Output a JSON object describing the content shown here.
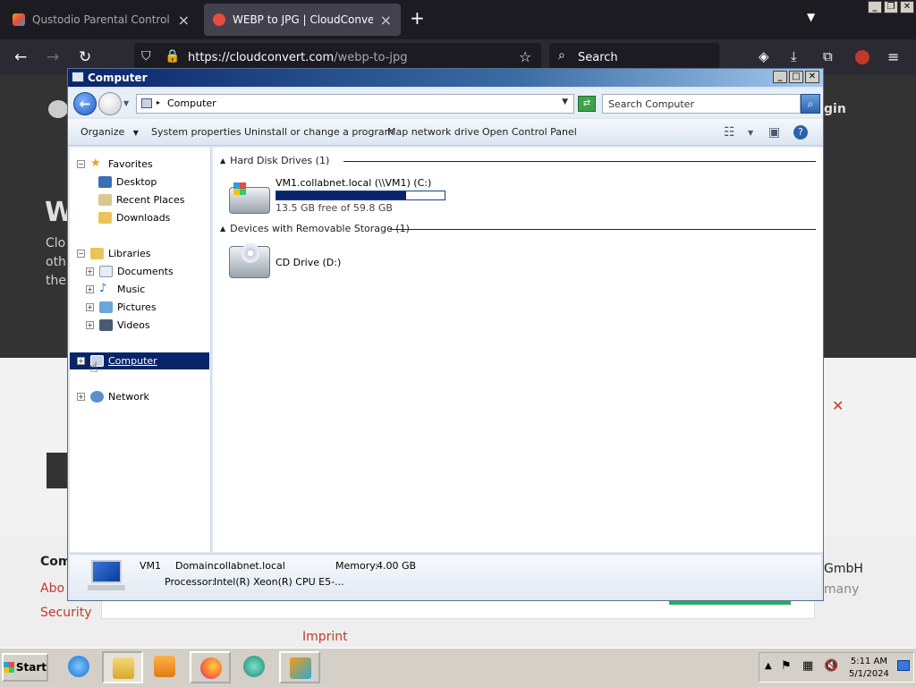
{
  "browser": {
    "tabs": [
      {
        "label": "Qustodio Parental Control App - A",
        "active": false
      },
      {
        "label": "WEBP to JPG | CloudConvert",
        "active": true
      }
    ],
    "url_host": "https://cloudconvert.com",
    "url_path": "/webp-to-jpg",
    "search_label": "Search",
    "win_buttons": [
      "_",
      "❐",
      "✕"
    ]
  },
  "site": {
    "title_letter": "W",
    "lines": [
      "Clo",
      "oth",
      "the"
    ],
    "login_partial": "gin",
    "footer_col1_head": "Com",
    "footer_col1_items": [
      "Abo",
      "Security"
    ],
    "footer_right1": "GmbH",
    "footer_right2": "many",
    "footer_center": "Imprint"
  },
  "explorer": {
    "title": "Computer",
    "address_text": "Computer",
    "search_placeholder": "Search Computer",
    "title_buttons": [
      "_",
      "□",
      "✕"
    ],
    "commands": {
      "organize": "Organize",
      "system_properties": "System properties",
      "uninstall": "Uninstall or change a program",
      "map_drive": "Map network drive",
      "control_panel": "Open Control Panel"
    },
    "tree": {
      "favorites": "Favorites",
      "desktop": "Desktop",
      "recent": "Recent Places",
      "downloads": "Downloads",
      "libraries": "Libraries",
      "documents": "Documents",
      "music": "Music",
      "pictures": "Pictures",
      "videos": "Videos",
      "computer": "Computer",
      "network": "Network"
    },
    "groups": {
      "hdd": "Hard Disk Drives (1)",
      "removable": "Devices with Removable Storage (1)"
    },
    "drive_c": {
      "name": "VM1.collabnet.local (\\\\VM1) (C:)",
      "free": "13.5 GB free of 59.8 GB",
      "used_fraction": 0.77
    },
    "drive_d": {
      "name": "CD Drive (D:)"
    },
    "details": {
      "name": "VM1",
      "domain_label": "Domain:",
      "domain_value": "collabnet.local",
      "memory_label": "Memory:",
      "memory_value": "4.00 GB",
      "processor_label": "Processor:",
      "processor_value": "Intel(R) Xeon(R) CPU E5-..."
    }
  },
  "taskbar": {
    "start": "Start",
    "time": "5:11 AM",
    "date": "5/1/2024"
  }
}
